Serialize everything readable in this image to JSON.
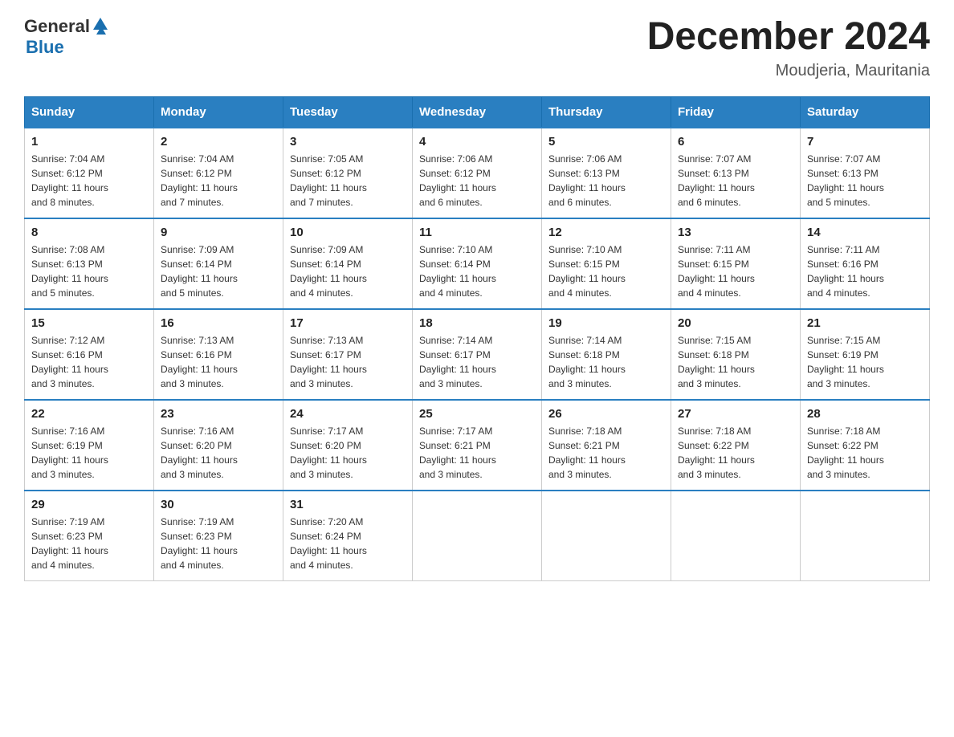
{
  "header": {
    "logo_general": "General",
    "logo_blue": "Blue",
    "title": "December 2024",
    "location": "Moudjeria, Mauritania"
  },
  "days_of_week": [
    "Sunday",
    "Monday",
    "Tuesday",
    "Wednesday",
    "Thursday",
    "Friday",
    "Saturday"
  ],
  "weeks": [
    [
      {
        "day": "1",
        "sunrise": "7:04 AM",
        "sunset": "6:12 PM",
        "daylight": "11 hours and 8 minutes."
      },
      {
        "day": "2",
        "sunrise": "7:04 AM",
        "sunset": "6:12 PM",
        "daylight": "11 hours and 7 minutes."
      },
      {
        "day": "3",
        "sunrise": "7:05 AM",
        "sunset": "6:12 PM",
        "daylight": "11 hours and 7 minutes."
      },
      {
        "day": "4",
        "sunrise": "7:06 AM",
        "sunset": "6:12 PM",
        "daylight": "11 hours and 6 minutes."
      },
      {
        "day": "5",
        "sunrise": "7:06 AM",
        "sunset": "6:13 PM",
        "daylight": "11 hours and 6 minutes."
      },
      {
        "day": "6",
        "sunrise": "7:07 AM",
        "sunset": "6:13 PM",
        "daylight": "11 hours and 6 minutes."
      },
      {
        "day": "7",
        "sunrise": "7:07 AM",
        "sunset": "6:13 PM",
        "daylight": "11 hours and 5 minutes."
      }
    ],
    [
      {
        "day": "8",
        "sunrise": "7:08 AM",
        "sunset": "6:13 PM",
        "daylight": "11 hours and 5 minutes."
      },
      {
        "day": "9",
        "sunrise": "7:09 AM",
        "sunset": "6:14 PM",
        "daylight": "11 hours and 5 minutes."
      },
      {
        "day": "10",
        "sunrise": "7:09 AM",
        "sunset": "6:14 PM",
        "daylight": "11 hours and 4 minutes."
      },
      {
        "day": "11",
        "sunrise": "7:10 AM",
        "sunset": "6:14 PM",
        "daylight": "11 hours and 4 minutes."
      },
      {
        "day": "12",
        "sunrise": "7:10 AM",
        "sunset": "6:15 PM",
        "daylight": "11 hours and 4 minutes."
      },
      {
        "day": "13",
        "sunrise": "7:11 AM",
        "sunset": "6:15 PM",
        "daylight": "11 hours and 4 minutes."
      },
      {
        "day": "14",
        "sunrise": "7:11 AM",
        "sunset": "6:16 PM",
        "daylight": "11 hours and 4 minutes."
      }
    ],
    [
      {
        "day": "15",
        "sunrise": "7:12 AM",
        "sunset": "6:16 PM",
        "daylight": "11 hours and 3 minutes."
      },
      {
        "day": "16",
        "sunrise": "7:13 AM",
        "sunset": "6:16 PM",
        "daylight": "11 hours and 3 minutes."
      },
      {
        "day": "17",
        "sunrise": "7:13 AM",
        "sunset": "6:17 PM",
        "daylight": "11 hours and 3 minutes."
      },
      {
        "day": "18",
        "sunrise": "7:14 AM",
        "sunset": "6:17 PM",
        "daylight": "11 hours and 3 minutes."
      },
      {
        "day": "19",
        "sunrise": "7:14 AM",
        "sunset": "6:18 PM",
        "daylight": "11 hours and 3 minutes."
      },
      {
        "day": "20",
        "sunrise": "7:15 AM",
        "sunset": "6:18 PM",
        "daylight": "11 hours and 3 minutes."
      },
      {
        "day": "21",
        "sunrise": "7:15 AM",
        "sunset": "6:19 PM",
        "daylight": "11 hours and 3 minutes."
      }
    ],
    [
      {
        "day": "22",
        "sunrise": "7:16 AM",
        "sunset": "6:19 PM",
        "daylight": "11 hours and 3 minutes."
      },
      {
        "day": "23",
        "sunrise": "7:16 AM",
        "sunset": "6:20 PM",
        "daylight": "11 hours and 3 minutes."
      },
      {
        "day": "24",
        "sunrise": "7:17 AM",
        "sunset": "6:20 PM",
        "daylight": "11 hours and 3 minutes."
      },
      {
        "day": "25",
        "sunrise": "7:17 AM",
        "sunset": "6:21 PM",
        "daylight": "11 hours and 3 minutes."
      },
      {
        "day": "26",
        "sunrise": "7:18 AM",
        "sunset": "6:21 PM",
        "daylight": "11 hours and 3 minutes."
      },
      {
        "day": "27",
        "sunrise": "7:18 AM",
        "sunset": "6:22 PM",
        "daylight": "11 hours and 3 minutes."
      },
      {
        "day": "28",
        "sunrise": "7:18 AM",
        "sunset": "6:22 PM",
        "daylight": "11 hours and 3 minutes."
      }
    ],
    [
      {
        "day": "29",
        "sunrise": "7:19 AM",
        "sunset": "6:23 PM",
        "daylight": "11 hours and 4 minutes."
      },
      {
        "day": "30",
        "sunrise": "7:19 AM",
        "sunset": "6:23 PM",
        "daylight": "11 hours and 4 minutes."
      },
      {
        "day": "31",
        "sunrise": "7:20 AM",
        "sunset": "6:24 PM",
        "daylight": "11 hours and 4 minutes."
      },
      null,
      null,
      null,
      null
    ]
  ],
  "labels": {
    "sunrise": "Sunrise:",
    "sunset": "Sunset:",
    "daylight": "Daylight:"
  }
}
